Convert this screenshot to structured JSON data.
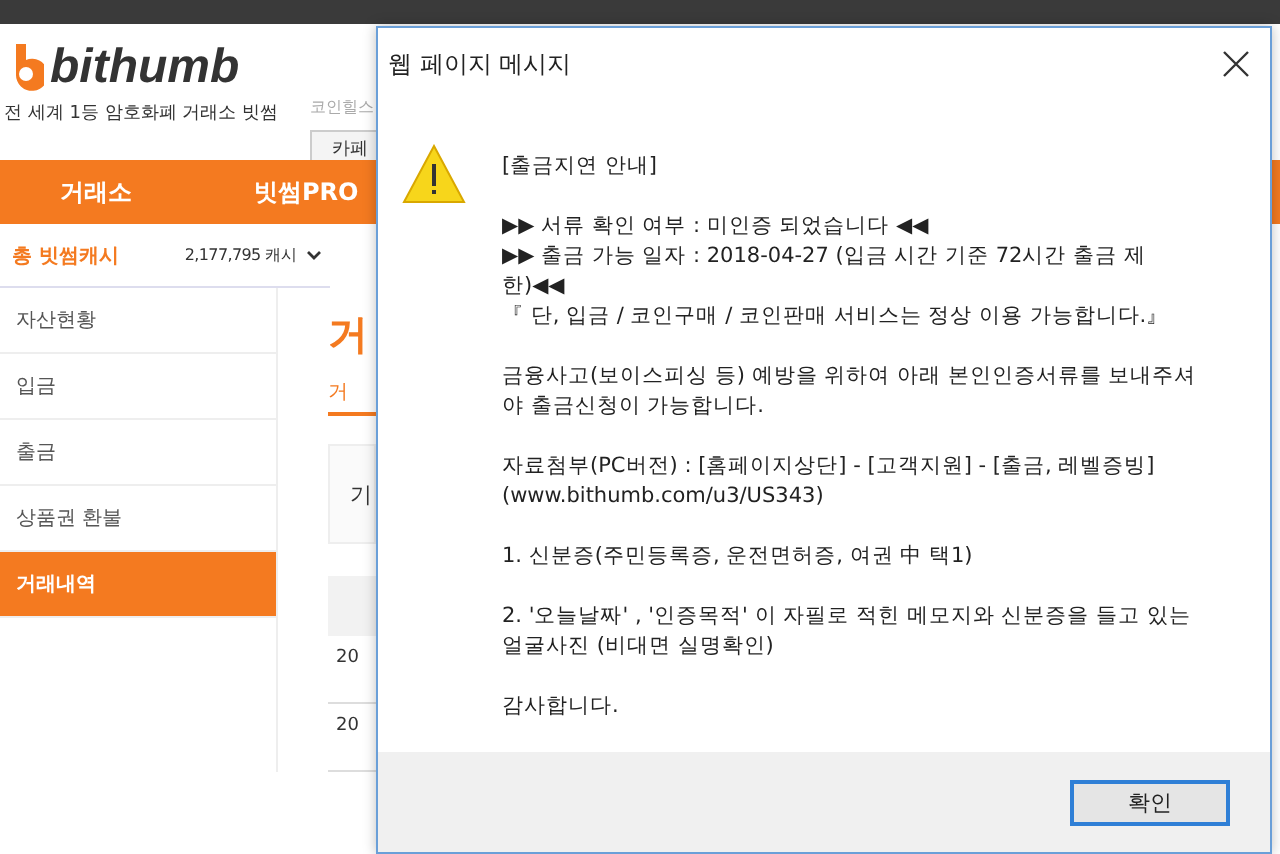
{
  "header": {
    "logo": "bithumb",
    "tagline": "전 세계 1등 암호화폐 거래소 빗썸",
    "coinhills": "코인힐스",
    "cafe_button": "카페"
  },
  "nav": [
    {
      "label": "거래소"
    },
    {
      "label": "빗썸PRO"
    }
  ],
  "cash": {
    "label": "총 빗썸캐시",
    "value": "2,177,795 캐시"
  },
  "sidebar": {
    "items": [
      {
        "label": "자산현황",
        "selected": false
      },
      {
        "label": "입금",
        "selected": false
      },
      {
        "label": "출금",
        "selected": false
      },
      {
        "label": "상품권 환불",
        "selected": false
      },
      {
        "label": "거래내역",
        "selected": true
      }
    ]
  },
  "main": {
    "heading": "거",
    "tab": "거",
    "filter_label": "기",
    "rows": [
      "20",
      "20"
    ]
  },
  "dialog": {
    "title": "웹 페이지 메시지",
    "blocks": [
      [
        "[출금지연 안내]"
      ],
      [
        "▶▶ 서류 확인 여부 : 미인증 되었습니다 ◀◀",
        "▶▶ 출금 가능 일자 : 2018-04-27 (입금 시간 기준 72시간 출금 제한)◀◀",
        "『 단, 입금 / 코인구매 / 코인판매 서비스는 정상 이용 가능합니다.』"
      ],
      [
        "금융사고(보이스피싱 등) 예방을 위하여 아래 본인인증서류를 보내주셔야 출금신청이 가능합니다."
      ],
      [
        "자료첨부(PC버전) : [홈페이지상단] - [고객지원] - [출금, 레벨증빙]",
        "(www.bithumb.com/u3/US343)"
      ],
      [
        "1. 신분증(주민등록증, 운전면허증, 여권 中 택1)"
      ],
      [
        "2. '오늘날짜' , '인증목적' 이 자필로 적힌 메모지와 신분증을 들고 있는 얼굴사진 (비대면 실명확인)"
      ],
      [
        "감사합니다."
      ]
    ],
    "ok_button": "확인"
  }
}
